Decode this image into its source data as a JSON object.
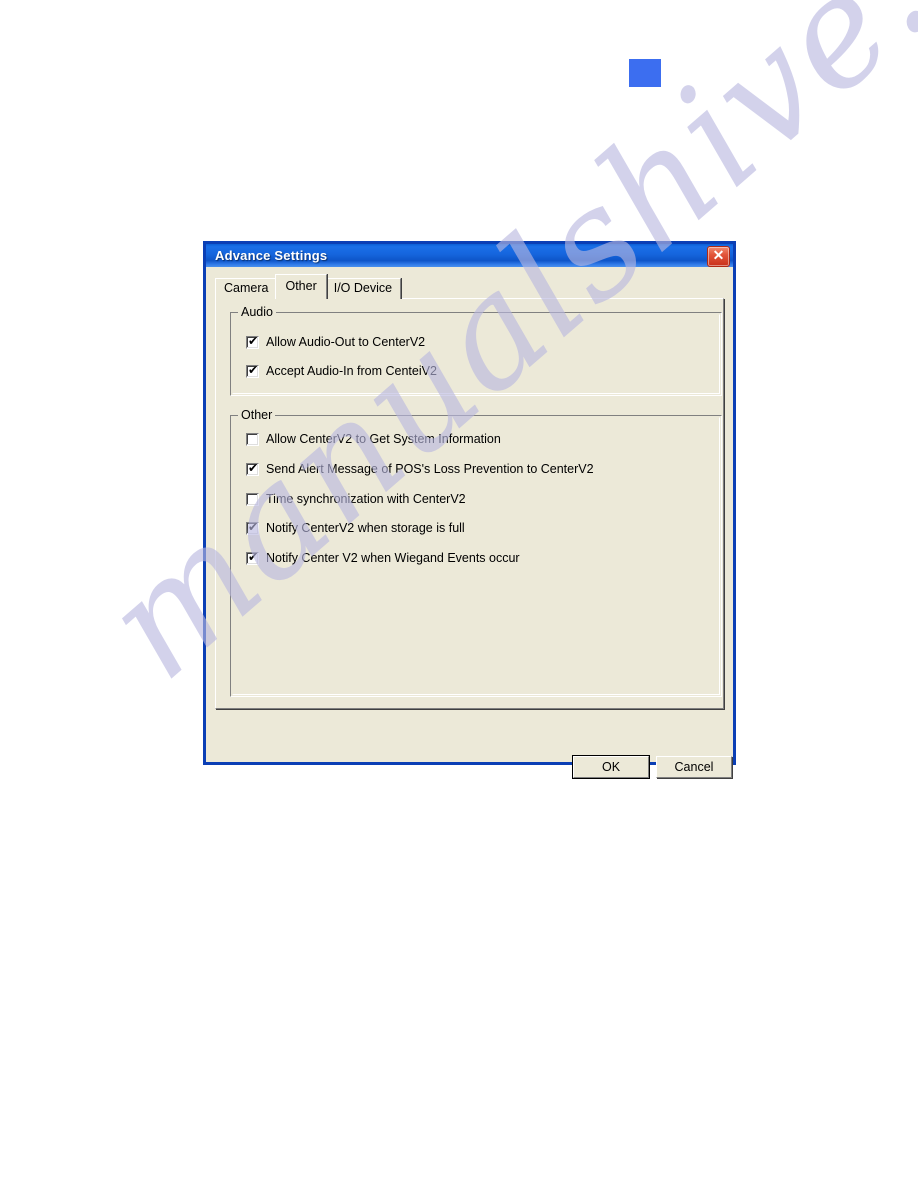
{
  "page": {
    "watermark": "manualshive.com",
    "watermark_color": "#b9b8e0",
    "background_color": "#ffffff"
  },
  "marker": {
    "name": "blue-square-marker",
    "color": "#3c6ef0"
  },
  "dialog": {
    "title": "Advance Settings",
    "titlebar_color": "#1565dd",
    "face_color": "#ece9d8",
    "border_color": "#0b3fb5",
    "close_button_label": "✕",
    "close_button_color": "#c8301a",
    "tabs": [
      {
        "label": "Camera",
        "selected": false
      },
      {
        "label": "Other",
        "selected": true
      },
      {
        "label": "I/O Device",
        "selected": false
      }
    ],
    "groups": [
      {
        "legend": "Audio",
        "items": [
          {
            "label": "Allow Audio-Out to CenterV2",
            "checked": true
          },
          {
            "label": "Accept Audio-In from CenteiV2",
            "checked": true
          }
        ]
      },
      {
        "legend": "Other",
        "items": [
          {
            "label": "Allow CenterV2 to Get System Information",
            "checked": false
          },
          {
            "label": "Send Alert Message of POS's Loss Prevention to CenterV2",
            "checked": true
          },
          {
            "label": "Time synchronization with CenterV2",
            "checked": false
          },
          {
            "label": "Notify CenterV2 when storage is full",
            "checked": true
          },
          {
            "label": "Notify Center V2 when Wiegand Events occur",
            "checked": true
          }
        ]
      }
    ],
    "buttons": {
      "ok_label": "OK",
      "cancel_label": "Cancel"
    }
  }
}
